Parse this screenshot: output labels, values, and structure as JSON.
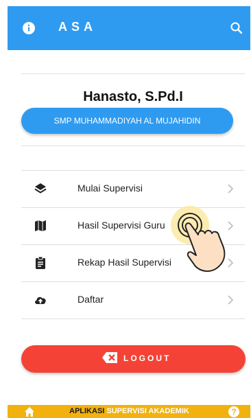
{
  "appbar": {
    "title": "ASA",
    "info_icon": "info-icon",
    "search_icon": "search-icon",
    "color": "#2f9bf0"
  },
  "profile": {
    "name": "Hanasto, S.Pd.I",
    "school": "SMP MUHAMMADIYAH AL MUJAHIDIN"
  },
  "menu": {
    "items": [
      {
        "label": "Mulai Supervisi",
        "icon": "layers-icon"
      },
      {
        "label": "Hasil Supervisi Guru",
        "icon": "map-icon"
      },
      {
        "label": "Rekap Hasil Supervisi",
        "icon": "clipboard-icon"
      },
      {
        "label": "Daftar",
        "icon": "cloud-upload-icon"
      }
    ]
  },
  "logout": {
    "label": "LOGOUT",
    "color": "#f44336"
  },
  "bottombar": {
    "text_part1": "APLIKASI",
    "text_part2": "SUPERVISI AKADEMIK",
    "color": "#f1b10f"
  }
}
